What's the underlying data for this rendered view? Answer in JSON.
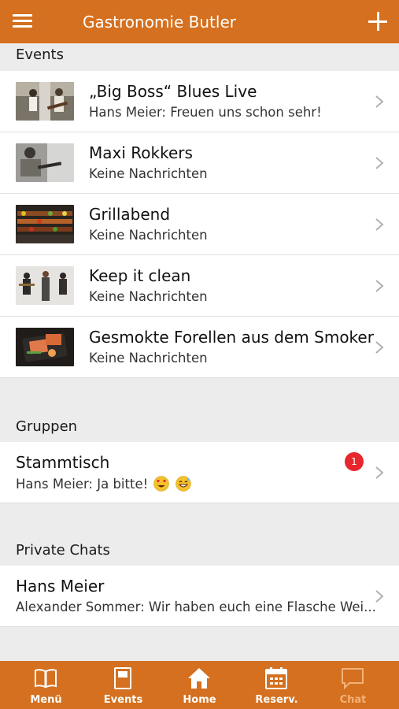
{
  "header": {
    "title": "Gastronomie Butler",
    "menu_icon": "hamburger-icon",
    "add_icon": "plus-icon"
  },
  "colors": {
    "brand": "#d4701f",
    "badge": "#e8262d",
    "active_tab": "#f2b27a"
  },
  "events": {
    "heading": "Events",
    "items": [
      {
        "title": "„Big Boss“ Blues Live",
        "subtitle": "Hans Meier: Freuen uns schon sehr!"
      },
      {
        "title": "Maxi Rokkers",
        "subtitle": "Keine Nachrichten"
      },
      {
        "title": "Grillabend",
        "subtitle": "Keine Nachrichten"
      },
      {
        "title": "Keep it clean",
        "subtitle": "Keine Nachrichten"
      },
      {
        "title": "Gesmokte Forellen aus dem Smoker",
        "subtitle": "Keine Nachrichten"
      }
    ]
  },
  "groups": {
    "heading": "Gruppen",
    "items": [
      {
        "title": "Stammtisch",
        "subtitle": "Hans Meier: Ja bitte!",
        "badge": "1",
        "emojis": [
          "heart-eyes-emoji",
          "grinning-sweat-emoji"
        ]
      }
    ]
  },
  "private_chats": {
    "heading": "Private Chats",
    "items": [
      {
        "title": "Hans Meier",
        "subtitle": "Alexander Sommer: Wir haben euch eine Flasche Wei..."
      }
    ]
  },
  "tabs": [
    {
      "label": "Menü",
      "icon": "book-icon"
    },
    {
      "label": "Events",
      "icon": "event-card-icon"
    },
    {
      "label": "Home",
      "icon": "home-icon"
    },
    {
      "label": "Reserv.",
      "icon": "calendar-icon"
    },
    {
      "label": "Chat",
      "icon": "chat-bubble-icon",
      "active": true
    }
  ]
}
